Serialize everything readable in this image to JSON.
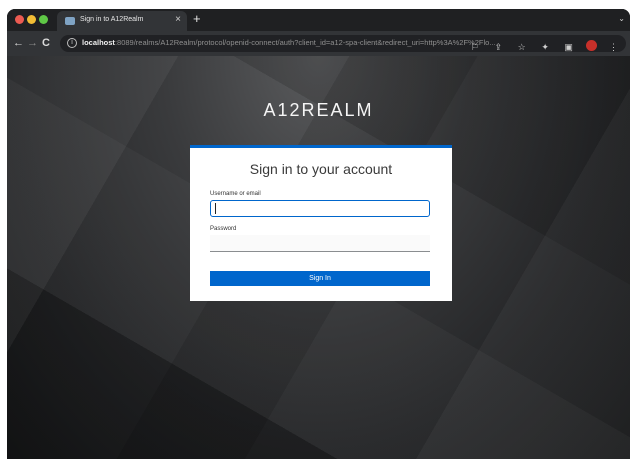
{
  "browser": {
    "tab": {
      "title": "Sign in to A12Realm",
      "close_symbol": "×",
      "favicon": "keycloak-favicon-icon"
    },
    "new_tab_symbol": "+",
    "tab_menu_symbol": "⌄",
    "nav": {
      "back_symbol": "←",
      "forward_symbol": "→",
      "reload_symbol": "C"
    },
    "address_bar": {
      "info_symbol": "i",
      "host": "localhost",
      "path": ":8089/realms/A12Realm/protocol/openid-connect/auth?client_id=a12-spa-client&redirect_uri=http%3A%2F%2Flo..."
    },
    "toolbar_icons": {
      "translate": "⚐",
      "share": "⇪",
      "bookmark": "☆",
      "extensions": "✦",
      "sidepanel": "▣",
      "menu": "⋮"
    }
  },
  "page": {
    "realm_title": "A12REALM",
    "form": {
      "heading": "Sign in to your account",
      "username_label": "Username or email",
      "username_value": "",
      "password_label": "Password",
      "password_value": "",
      "submit_label": "Sign In"
    }
  },
  "colors": {
    "accent": "#0066cc",
    "traffic_red": "#ec5b52",
    "traffic_yellow": "#f2bd35",
    "traffic_green": "#5fc846"
  }
}
